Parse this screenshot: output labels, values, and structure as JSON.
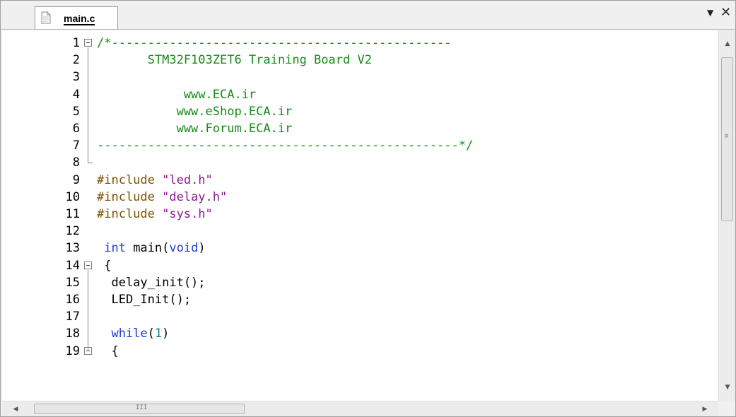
{
  "tab": {
    "label": "main.c",
    "menu_glyph": "▼",
    "close_glyph": "✕"
  },
  "editor": {
    "lines": [
      {
        "num": "1",
        "fold": "open",
        "parts": [
          {
            "cls": "c-comment",
            "t": "/*-----------------------------------------------"
          }
        ]
      },
      {
        "num": "2",
        "parts": [
          {
            "cls": "c-comment",
            "t": "       STM32F103ZET6 Training Board V2"
          }
        ]
      },
      {
        "num": "3",
        "parts": [
          {
            "cls": "c-comment",
            "t": ""
          }
        ]
      },
      {
        "num": "4",
        "parts": [
          {
            "cls": "c-comment",
            "t": "            www.ECA.ir"
          }
        ]
      },
      {
        "num": "5",
        "parts": [
          {
            "cls": "c-comment",
            "t": "           www.eShop.ECA.ir"
          }
        ]
      },
      {
        "num": "6",
        "parts": [
          {
            "cls": "c-comment",
            "t": "           www.Forum.ECA.ir"
          }
        ]
      },
      {
        "num": "7",
        "parts": [
          {
            "cls": "c-comment",
            "t": "--------------------------------------------------*/"
          }
        ]
      },
      {
        "num": "8",
        "parts": [
          {
            "cls": "c-plain",
            "t": ""
          }
        ]
      },
      {
        "num": "9",
        "parts": [
          {
            "cls": "c-pre",
            "t": "#include "
          },
          {
            "cls": "c-str",
            "t": "\"led.h\""
          }
        ]
      },
      {
        "num": "10",
        "parts": [
          {
            "cls": "c-pre",
            "t": "#include "
          },
          {
            "cls": "c-str",
            "t": "\"delay.h\""
          }
        ]
      },
      {
        "num": "11",
        "parts": [
          {
            "cls": "c-pre",
            "t": "#include "
          },
          {
            "cls": "c-str",
            "t": "\"sys.h\""
          }
        ]
      },
      {
        "num": "12",
        "parts": [
          {
            "cls": "c-plain",
            "t": ""
          }
        ]
      },
      {
        "num": "13",
        "parts": [
          {
            "cls": "c-kw",
            "t": " int"
          },
          {
            "cls": "c-plain",
            "t": " main("
          },
          {
            "cls": "c-kw",
            "t": "void"
          },
          {
            "cls": "c-plain",
            "t": ")"
          }
        ]
      },
      {
        "num": "14",
        "fold": "open",
        "parts": [
          {
            "cls": "c-plain",
            "t": " {"
          }
        ]
      },
      {
        "num": "15",
        "parts": [
          {
            "cls": "c-plain",
            "t": "  delay_init();"
          }
        ]
      },
      {
        "num": "16",
        "parts": [
          {
            "cls": "c-plain",
            "t": "  LED_Init();"
          }
        ]
      },
      {
        "num": "17",
        "parts": [
          {
            "cls": "c-plain",
            "t": ""
          }
        ]
      },
      {
        "num": "18",
        "parts": [
          {
            "cls": "c-kw",
            "t": "  while"
          },
          {
            "cls": "c-plain",
            "t": "("
          },
          {
            "cls": "c-num",
            "t": "1"
          },
          {
            "cls": "c-plain",
            "t": ")"
          }
        ]
      },
      {
        "num": "19",
        "fold": "open",
        "parts": [
          {
            "cls": "c-plain",
            "t": "  {"
          }
        ]
      }
    ]
  },
  "vscroll": {
    "up_glyph": "▲",
    "down_glyph": "▼",
    "grip": "≡"
  },
  "hscroll": {
    "left_glyph": "◀",
    "right_glyph": "▶",
    "grip": "III"
  }
}
